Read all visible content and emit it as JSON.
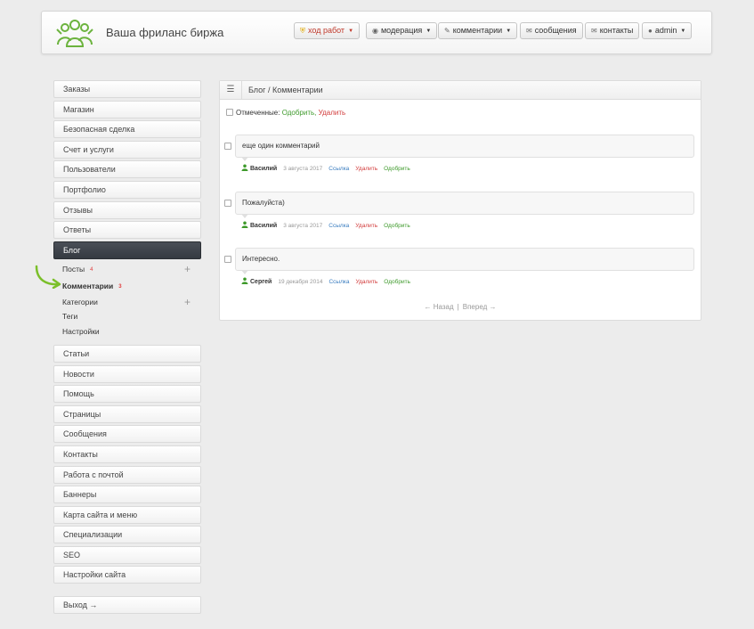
{
  "header": {
    "site_title": "Ваша фриланс биржа",
    "buttons": {
      "progress": "ход работ",
      "moderation": "модерация",
      "comments": "комментарии",
      "messages": "сообщения",
      "contacts": "контакты",
      "user": "admin"
    }
  },
  "sidebar": {
    "items_top": [
      "Заказы",
      "Магазин",
      "Безопасная сделка",
      "Счет и услуги",
      "Пользователи",
      "Портфолио",
      "Отзывы",
      "Ответы"
    ],
    "active": "Блог",
    "sub": {
      "posts": "Посты",
      "posts_count": "4",
      "comments": "Комментарии",
      "comments_count": "3",
      "categories": "Категории",
      "tags": "Теги",
      "settings": "Настройки"
    },
    "items_bottom": [
      "Статьи",
      "Новости",
      "Помощь",
      "Страницы",
      "Сообщения",
      "Контакты",
      "Работа с почтой",
      "Баннеры",
      "Карта сайта и меню",
      "Специализации",
      "SEO",
      "Настройки сайта"
    ],
    "logout": "Выход →"
  },
  "main": {
    "breadcrumb": "Блог / Комментарии",
    "marked_label": "Отмеченные:",
    "approve": "Одобрить,",
    "delete": "Удалить",
    "comments": [
      {
        "text": "еще один комментарий",
        "author": "Василий",
        "date": "3 августа 2017",
        "link": "Ссылка",
        "delete": "Удалить",
        "approve": "Одобрить"
      },
      {
        "text": "Пожалуйста)",
        "author": "Василий",
        "date": "3 августа 2017",
        "link": "Ссылка",
        "delete": "Удалить",
        "approve": "Одобрить"
      },
      {
        "text": "Интересно.",
        "author": "Сергей",
        "date": "19 декабря 2014",
        "link": "Ссылка",
        "delete": "Удалить",
        "approve": "Одобрить"
      }
    ],
    "pager": {
      "prev": "← Назад",
      "sep": "|",
      "next": "Вперед →"
    }
  }
}
